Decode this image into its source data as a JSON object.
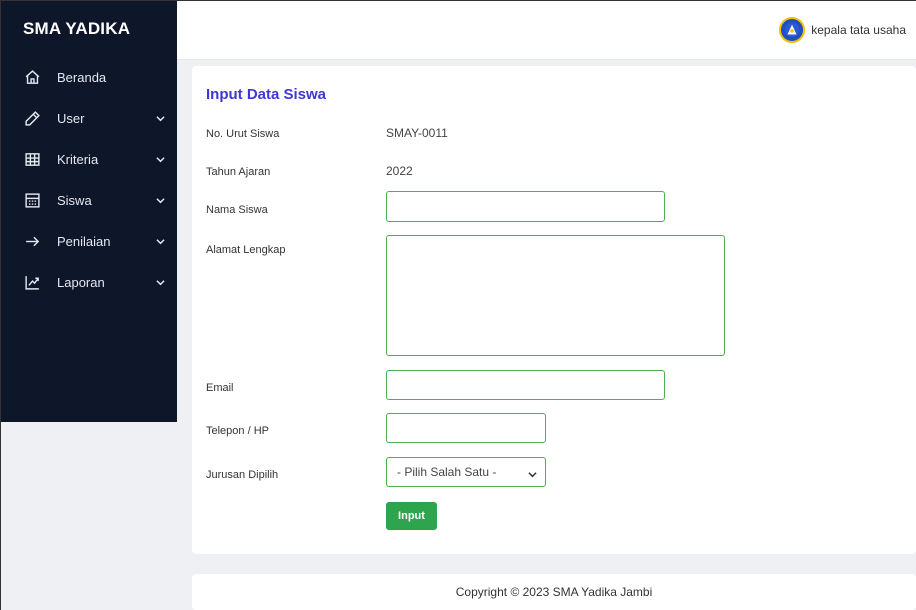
{
  "brand": "SMA YADIKA",
  "sidebar": {
    "items": [
      {
        "label": "Beranda",
        "icon": "home-icon",
        "has_chevron": false
      },
      {
        "label": "User",
        "icon": "pencil-icon",
        "has_chevron": true
      },
      {
        "label": "Kriteria",
        "icon": "table-icon",
        "has_chevron": true
      },
      {
        "label": "Siswa",
        "icon": "calculator-icon",
        "has_chevron": true
      },
      {
        "label": "Penilaian",
        "icon": "arrow-right-icon",
        "has_chevron": true
      },
      {
        "label": "Laporan",
        "icon": "chart-line-icon",
        "has_chevron": true
      }
    ]
  },
  "topbar": {
    "user_name": "kepala tata usaha"
  },
  "form": {
    "title": "Input Data Siswa",
    "no_urut_label": "No. Urut Siswa",
    "no_urut_value": "SMAY-0011",
    "tahun_label": "Tahun Ajaran",
    "tahun_value": "2022",
    "nama_label": "Nama Siswa",
    "nama_value": "",
    "alamat_label": "Alamat Lengkap",
    "alamat_value": "",
    "email_label": "Email",
    "email_value": "",
    "telepon_label": "Telepon / HP",
    "telepon_value": "",
    "jurusan_label": "Jurusan Dipilih",
    "jurusan_selected": "- Pilih Salah Satu -",
    "submit_label": "Input"
  },
  "footer": {
    "text": "Copyright © 2023 SMA Yadika Jambi"
  },
  "colors": {
    "sidebar_bg": "#0e1629",
    "accent_title": "#3f36d8",
    "input_border": "#4caf50",
    "button_bg": "#2ea44f"
  }
}
